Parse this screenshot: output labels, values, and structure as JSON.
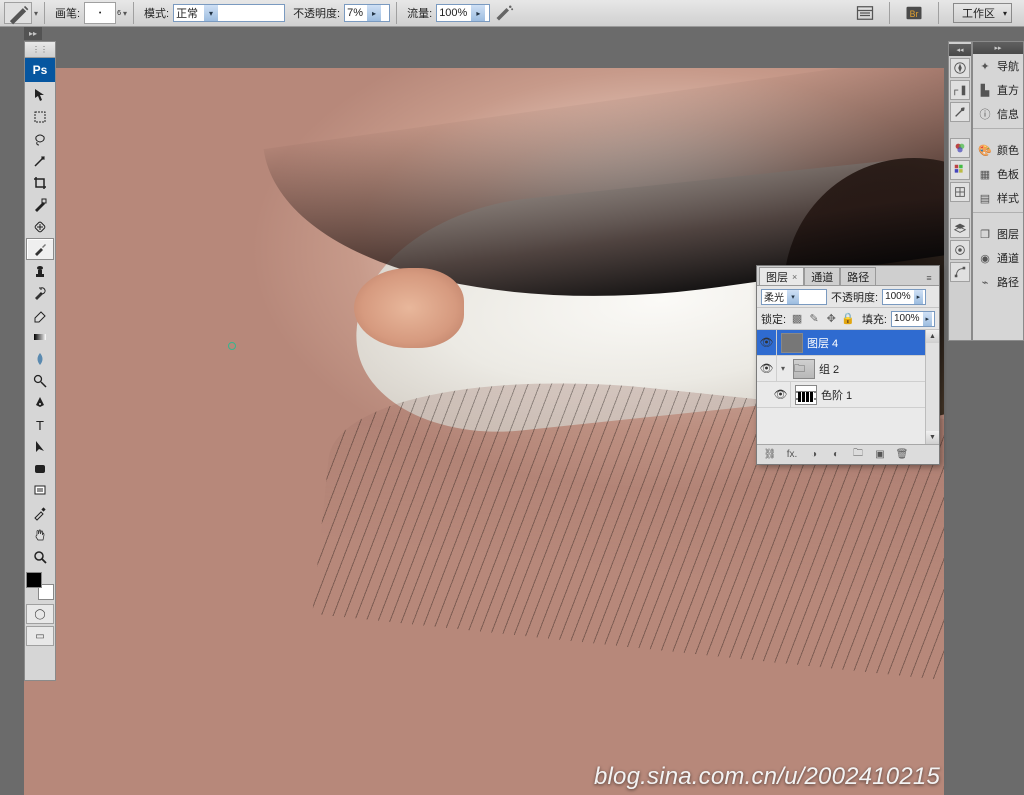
{
  "options_bar": {
    "brush_label": "画笔:",
    "brush_size": "6",
    "mode_label": "模式:",
    "mode_value": "正常",
    "opacity_label": "不透明度:",
    "opacity_value": "7%",
    "flow_label": "流量:",
    "flow_value": "100%",
    "workspace_label": "工作区"
  },
  "toolbox": {
    "tools": [
      "move",
      "marquee",
      "lasso",
      "wand",
      "crop",
      "slice",
      "heal",
      "brush",
      "stamp",
      "history-brush",
      "eraser",
      "gradient",
      "blur",
      "dodge",
      "pen",
      "type",
      "path-select",
      "shape",
      "notes",
      "eyedropper",
      "hand",
      "zoom"
    ]
  },
  "right_dock": {
    "items": [
      {
        "icon": "nav",
        "label": "导航"
      },
      {
        "icon": "hist",
        "label": "直方"
      },
      {
        "icon": "info",
        "label": "信息"
      },
      {
        "icon": "color",
        "label": "颜色"
      },
      {
        "icon": "swatch",
        "label": "色板"
      },
      {
        "icon": "styles",
        "label": "样式"
      },
      {
        "icon": "layers",
        "label": "图层"
      },
      {
        "icon": "channels",
        "label": "通道"
      },
      {
        "icon": "paths",
        "label": "路径"
      }
    ]
  },
  "layers_panel": {
    "tabs": {
      "layers": "图层",
      "channels": "通道",
      "paths": "路径"
    },
    "blend_label": "",
    "blend_value": "柔光",
    "opacity_label": "不透明度:",
    "opacity_value": "100%",
    "lock_label": "锁定:",
    "fill_label": "填充:",
    "fill_value": "100%",
    "items": [
      {
        "name": "图层 4",
        "type": "raster",
        "selected": true,
        "visible": true
      },
      {
        "name": "组 2",
        "type": "group",
        "selected": false,
        "visible": true
      },
      {
        "name": "色阶 1",
        "type": "levels",
        "selected": false,
        "visible": true
      }
    ]
  },
  "watermark": "blog.sina.com.cn/u/2002410215"
}
